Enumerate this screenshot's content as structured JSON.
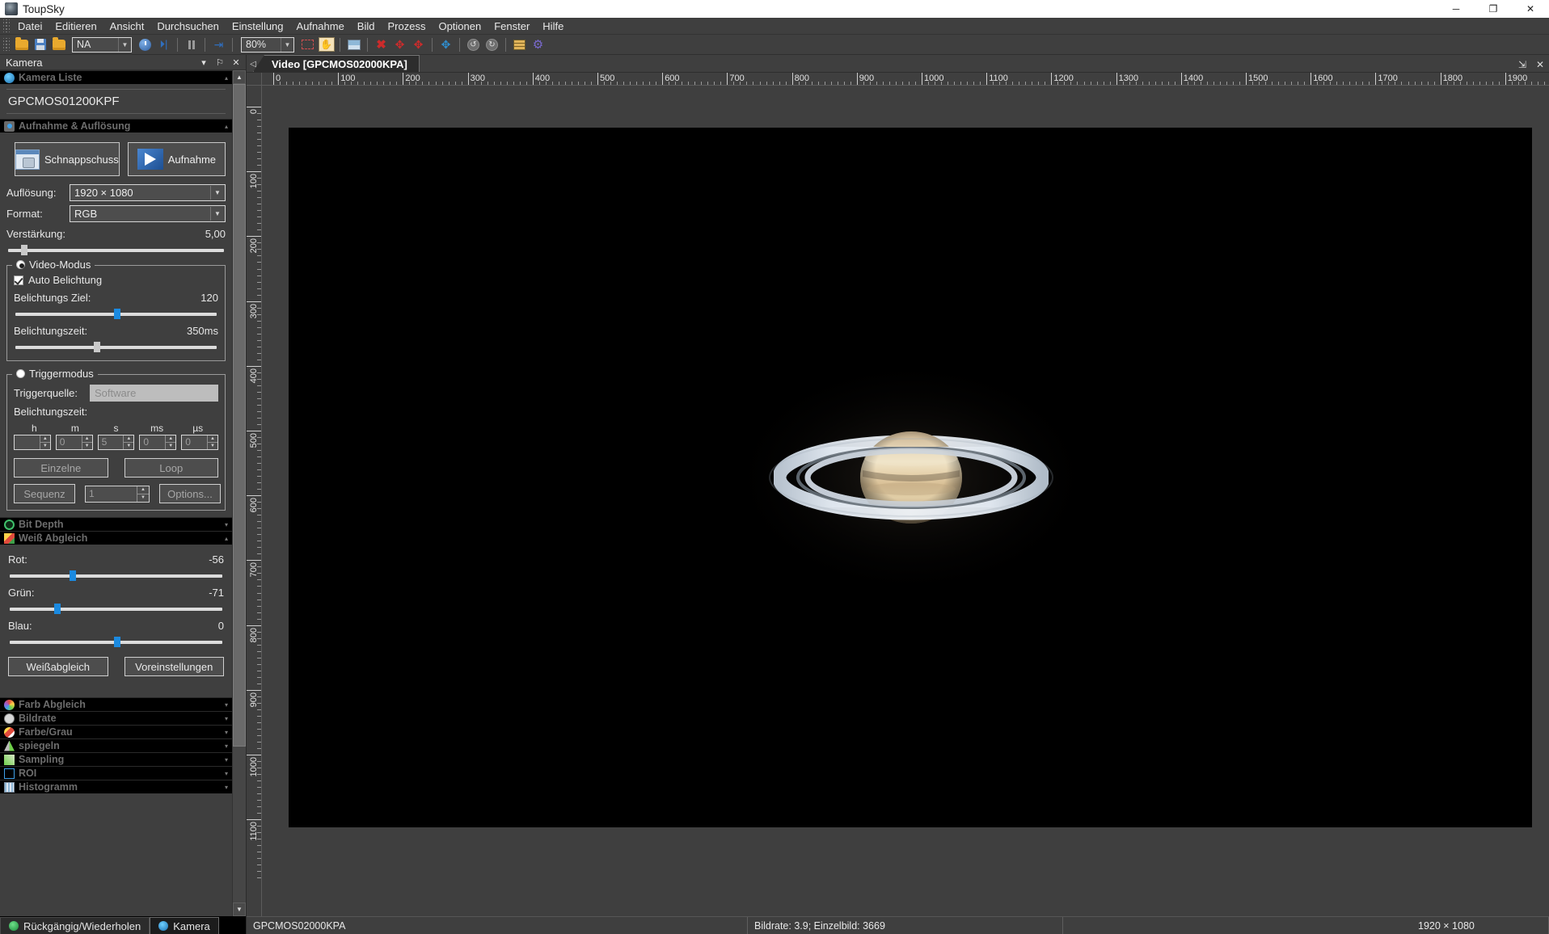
{
  "window": {
    "title": "ToupSky",
    "minimize": "─",
    "maximize": "❐",
    "close": "✕"
  },
  "menubar": {
    "items": [
      "Datei",
      "Editieren",
      "Ansicht",
      "Durchsuchen",
      "Einstellung",
      "Aufnahme",
      "Bild",
      "Prozess",
      "Optionen",
      "Fenster",
      "Hilfe"
    ]
  },
  "toolbar": {
    "device_combo": {
      "value": "NA",
      "arrow": "▼"
    },
    "zoom_combo": {
      "value": "80%",
      "arrow": "▼"
    },
    "icons": [
      "open-folder-icon",
      "save-icon",
      "open-image-icon",
      "timer-icon",
      "start-icon",
      "pause-icon",
      "next-frame-icon",
      "select-region-icon",
      "pan-hand-icon",
      "image-adjust-icon",
      "delete-all-icon",
      "delete-icon",
      "delete-marker-icon",
      "move-icon",
      "rotate-left-icon",
      "rotate-right-icon",
      "grid-icon",
      "settings-icon"
    ]
  },
  "dock": {
    "title": "Kamera",
    "buttons": {
      "menu": "▾",
      "pin": "⚐",
      "close": "✕"
    }
  },
  "sections": {
    "camera_list": {
      "title": "Kamera Liste",
      "chevron": "▴",
      "selected_camera": "GPCMOS01200KPF"
    },
    "capture": {
      "title": "Aufnahme & Auflösung",
      "chevron": "▴",
      "snapshot_button": "Schnappschuss",
      "record_button": "Aufnahme",
      "resolution_label": "Auflösung:",
      "resolution_value": "1920 × 1080",
      "format_label": "Format:",
      "format_value": "RGB",
      "gain_label": "Verstärkung:",
      "gain_value": "5,00",
      "gain_percent": 7,
      "video_mode": {
        "legend": "Video-Modus",
        "selected": true,
        "auto_exposure_label": "Auto Belichtung",
        "auto_exposure_checked": true,
        "target_label": "Belichtungs Ziel:",
        "target_value": "120",
        "target_percent": 50,
        "exposure_label": "Belichtungszeit:",
        "exposure_value": "350ms",
        "exposure_percent": 39
      },
      "trigger_mode": {
        "legend": "Triggermodus",
        "selected": false,
        "source_label": "Triggerquelle:",
        "source_value": "Software",
        "exposure_label": "Belichtungszeit:",
        "units": [
          "h",
          "m",
          "s",
          "ms",
          "µs"
        ],
        "values": [
          "",
          "0",
          "5",
          "0",
          "0"
        ],
        "single_button": "Einzelne",
        "loop_button": "Loop",
        "sequence_button": "Sequenz",
        "sequence_count": "1",
        "options_button": "Options..."
      }
    },
    "bit_depth": {
      "title": "Bit Depth",
      "chevron": "▾"
    },
    "white_balance": {
      "title": "Weiß Abgleich",
      "chevron": "▴",
      "red_label": "Rot:",
      "red_value": "-56",
      "red_percent": 29,
      "green_label": "Grün:",
      "green_value": "-71",
      "green_percent": 22,
      "blue_label": "Blau:",
      "blue_value": "0",
      "blue_percent": 50,
      "wb_button": "Weißabgleich",
      "defaults_button": "Voreinstellungen"
    },
    "collapsed": [
      {
        "title": "Farb Abgleich",
        "icon": "color-wheel-icon",
        "chevron": "▾"
      },
      {
        "title": "Bildrate",
        "icon": "clock-icon",
        "chevron": "▾"
      },
      {
        "title": "Farbe/Grau",
        "icon": "color-gray-icon",
        "chevron": "▾"
      },
      {
        "title": "spiegeln",
        "icon": "mirror-icon",
        "chevron": "▾"
      },
      {
        "title": "Sampling",
        "icon": "pencil-icon",
        "chevron": "▾"
      },
      {
        "title": "ROI",
        "icon": "roi-icon",
        "chevron": "▾"
      },
      {
        "title": "Histogramm",
        "icon": "histogram-icon",
        "chevron": "▾"
      }
    ]
  },
  "bottom_tabs": [
    {
      "label": "Rückgängig/Wiederholen",
      "icon": "undo-redo-icon",
      "active": false
    },
    {
      "label": "Kamera",
      "icon": "camera-icon",
      "active": true
    }
  ],
  "document": {
    "tab_label": "Video [GPCMOS02000KPA]",
    "nav_left": "◁",
    "float_icon": "⇲",
    "close_icon": "✕"
  },
  "rulers": {
    "horizontal": [
      "0",
      "100",
      "200",
      "300",
      "400",
      "500",
      "600",
      "700",
      "800",
      "900",
      "1000",
      "1100",
      "1200",
      "1300",
      "1400",
      "1500",
      "1600",
      "1700",
      "1800",
      "1900"
    ],
    "vertical": [
      "0",
      "100",
      "200",
      "300",
      "400",
      "500",
      "600",
      "700",
      "800",
      "900",
      "1000",
      "1100"
    ]
  },
  "statusbar": {
    "camera": "GPCMOS02000KPA",
    "framerate": "Bildrate: 3.9; Einzelbild: 3669",
    "resolution": "1920 × 1080"
  },
  "colors": {
    "accent": "#1b8ae0",
    "panel": "#3f3f3f",
    "section_header": "#000000",
    "canvas": "#000000"
  }
}
